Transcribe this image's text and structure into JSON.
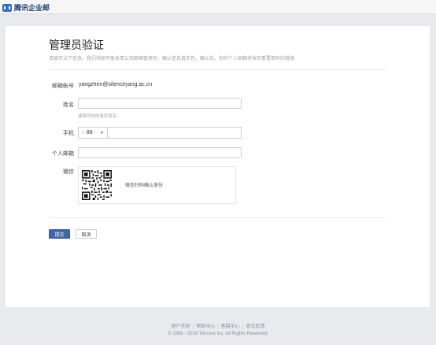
{
  "header": {
    "brand": "腾讯企业邮"
  },
  "form": {
    "title": "管理员验证",
    "subtitle": "请填写以下信息。我们将邮件联系贵公司邮箱管理员，确认信息真实性。确认后，你的个人邮箱将收到重置密码的链接",
    "email_label": "邮箱帐号",
    "email_value": "yangzhen@silenceyang.ac.cn",
    "name_label": "姓名",
    "name_value": "",
    "name_hint": "请填写你的真实姓名",
    "phone_label": "手机",
    "phone_country_code": "86",
    "phone_value": "",
    "personal_email_label": "个人邮箱",
    "personal_email_value": "",
    "wechat_label": "微信",
    "wechat_instruction": "微信扫码确认身份",
    "submit_label": "提交",
    "cancel_label": "取消"
  },
  "footer": {
    "links": [
      "用户手册",
      "帮助中心",
      "客服中心",
      "意见反馈"
    ],
    "copyright": "© 1998 - 2019 Tencent Inc. All Rights Reserved."
  },
  "colors": {
    "accent": "#3f67a8",
    "brand": "#2f6fc1",
    "page_bg": "#e9eaed"
  },
  "icons": {
    "brand_logo": "tencent-mail-logo-icon",
    "qr": "wechat-qr-code-icon"
  }
}
